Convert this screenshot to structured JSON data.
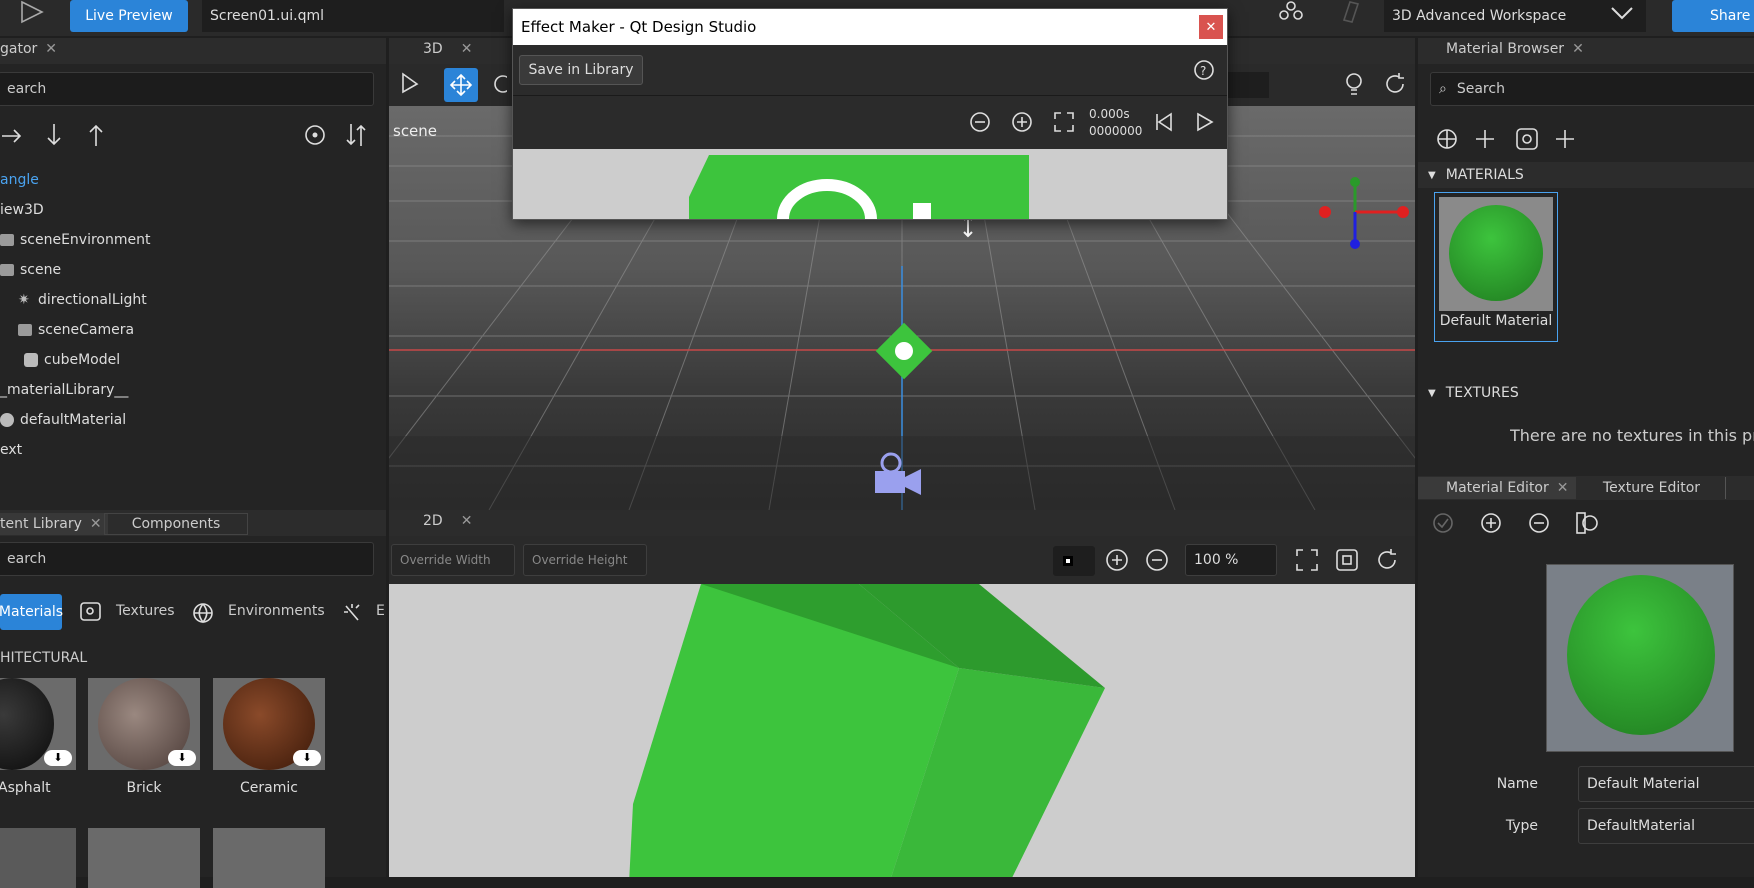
{
  "topbar": {
    "live_preview": "Live Preview",
    "file_name": "Screen01.ui.qml",
    "workspace": "3D Advanced Workspace",
    "share": "Share"
  },
  "navigator": {
    "tab": "gator",
    "search": "earch",
    "items": [
      {
        "label": "angle",
        "selected": true
      },
      {
        "label": "iew3D"
      },
      {
        "label": "sceneEnvironment"
      },
      {
        "label": "scene"
      },
      {
        "label": "directionalLight"
      },
      {
        "label": "sceneCamera"
      },
      {
        "label": "cubeModel"
      },
      {
        "label": "_materialLibrary__"
      },
      {
        "label": "defaultMaterial"
      },
      {
        "label": "ext"
      }
    ]
  },
  "content_library": {
    "tab": "tent Library",
    "components_tab": "Components",
    "search": "earch",
    "categories": [
      "Materials",
      "Textures",
      "Environments",
      "E"
    ],
    "section": "HITECTURAL",
    "materials": [
      {
        "label": "Asphalt"
      },
      {
        "label": "Brick"
      },
      {
        "label": "Ceramic"
      }
    ]
  },
  "view3d": {
    "tab": "3D",
    "scene_label": "scene"
  },
  "view2d": {
    "tab": "2D",
    "override_width": "Override Width",
    "override_height": "Override Height",
    "zoom": "100 %"
  },
  "effect_maker": {
    "title": "Effect Maker - Qt Design Studio",
    "save_button": "Save in Library",
    "time": "0.000s",
    "frame": "0000000"
  },
  "material_browser": {
    "tab": "Material Browser",
    "search": "Search",
    "materials_section": "MATERIALS",
    "material_name": "Default Material",
    "textures_section": "TEXTURES",
    "no_textures": "There are no textures in this pro"
  },
  "material_editor": {
    "tab": "Material Editor",
    "texture_tab": "Texture Editor",
    "name_label": "Name",
    "name_value": "Default Material",
    "type_label": "Type",
    "type_value": "DefaultMaterial"
  },
  "colors": {
    "accent": "#2b84d8",
    "green": "#3dc43d"
  }
}
